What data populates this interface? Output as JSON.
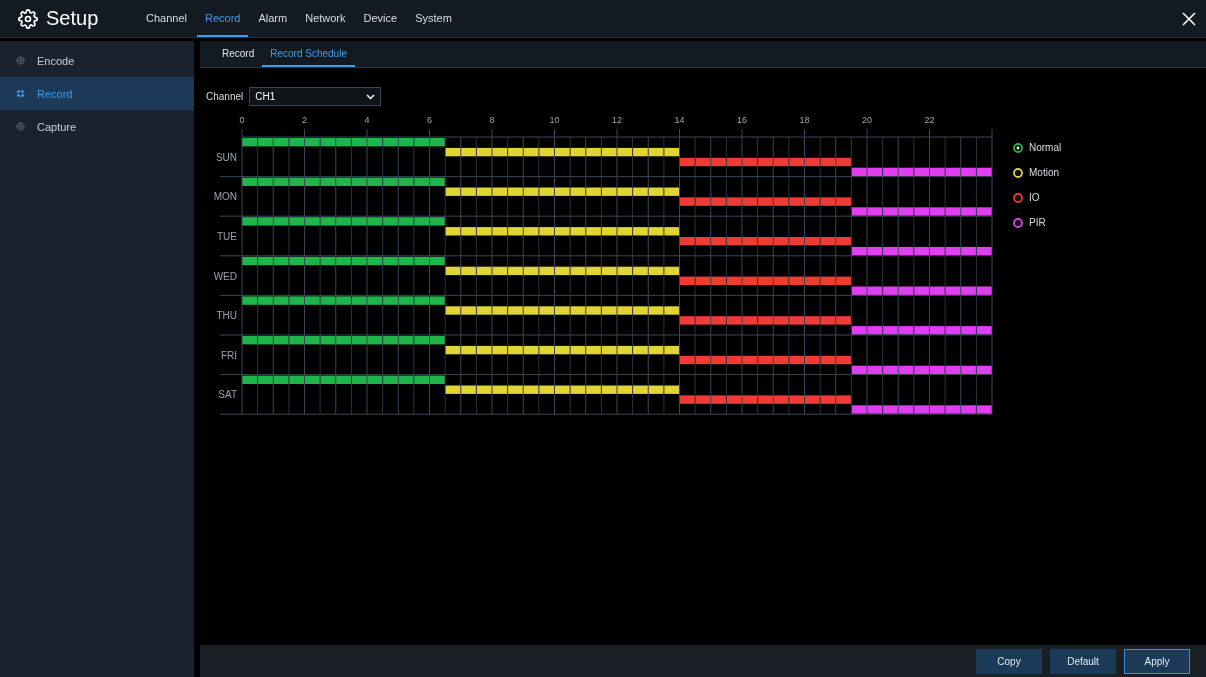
{
  "header": {
    "title": "Setup",
    "tabs": [
      {
        "label": "Channel",
        "selected": false
      },
      {
        "label": "Record",
        "selected": true
      },
      {
        "label": "Alarm",
        "selected": false
      },
      {
        "label": "Network",
        "selected": false
      },
      {
        "label": "Device",
        "selected": false
      },
      {
        "label": "System",
        "selected": false
      }
    ]
  },
  "sidebar": {
    "items": [
      {
        "label": "Encode",
        "selected": false
      },
      {
        "label": "Record",
        "selected": true
      },
      {
        "label": "Capture",
        "selected": false
      }
    ]
  },
  "subtabs": [
    {
      "label": "Record",
      "selected": false
    },
    {
      "label": "Record Schedule",
      "selected": true
    }
  ],
  "channel": {
    "label": "Channel",
    "value": "CH1"
  },
  "schedule": {
    "chart_data": {
      "type": "bar",
      "orientation": "horizontal",
      "stacked": true,
      "categories": [
        "SUN",
        "MON",
        "TUE",
        "WED",
        "THU",
        "FRI",
        "SAT"
      ],
      "xlim": [
        0,
        24
      ],
      "xticks": [
        0,
        2,
        4,
        6,
        8,
        10,
        12,
        14,
        16,
        18,
        20,
        22
      ],
      "grid": true,
      "legend": "right",
      "series": [
        {
          "name": "Normal",
          "color": "#1fb54a",
          "values": [
            6.5,
            6.5,
            6.5,
            6.5,
            6.5,
            6.5,
            6.5
          ]
        },
        {
          "name": "Motion",
          "color": "#e0d532",
          "values": [
            7.5,
            7.5,
            7.5,
            7.5,
            7.5,
            7.5,
            7.5
          ]
        },
        {
          "name": "IO",
          "color": "#f23a35",
          "values": [
            5.5,
            5.5,
            5.5,
            5.5,
            5.5,
            5.5,
            5.5
          ]
        },
        {
          "name": "PIR",
          "color": "#e03ef0",
          "values": [
            4.5,
            4.5,
            4.5,
            4.5,
            4.5,
            4.5,
            4.5
          ]
        }
      ]
    },
    "legend": [
      {
        "selected": true
      },
      {
        "selected": false
      },
      {
        "selected": false
      },
      {
        "selected": false
      }
    ]
  },
  "buttons": [
    {
      "label": "Copy",
      "selected": false
    },
    {
      "label": "Default",
      "selected": false
    },
    {
      "label": "Apply",
      "selected": true
    }
  ]
}
